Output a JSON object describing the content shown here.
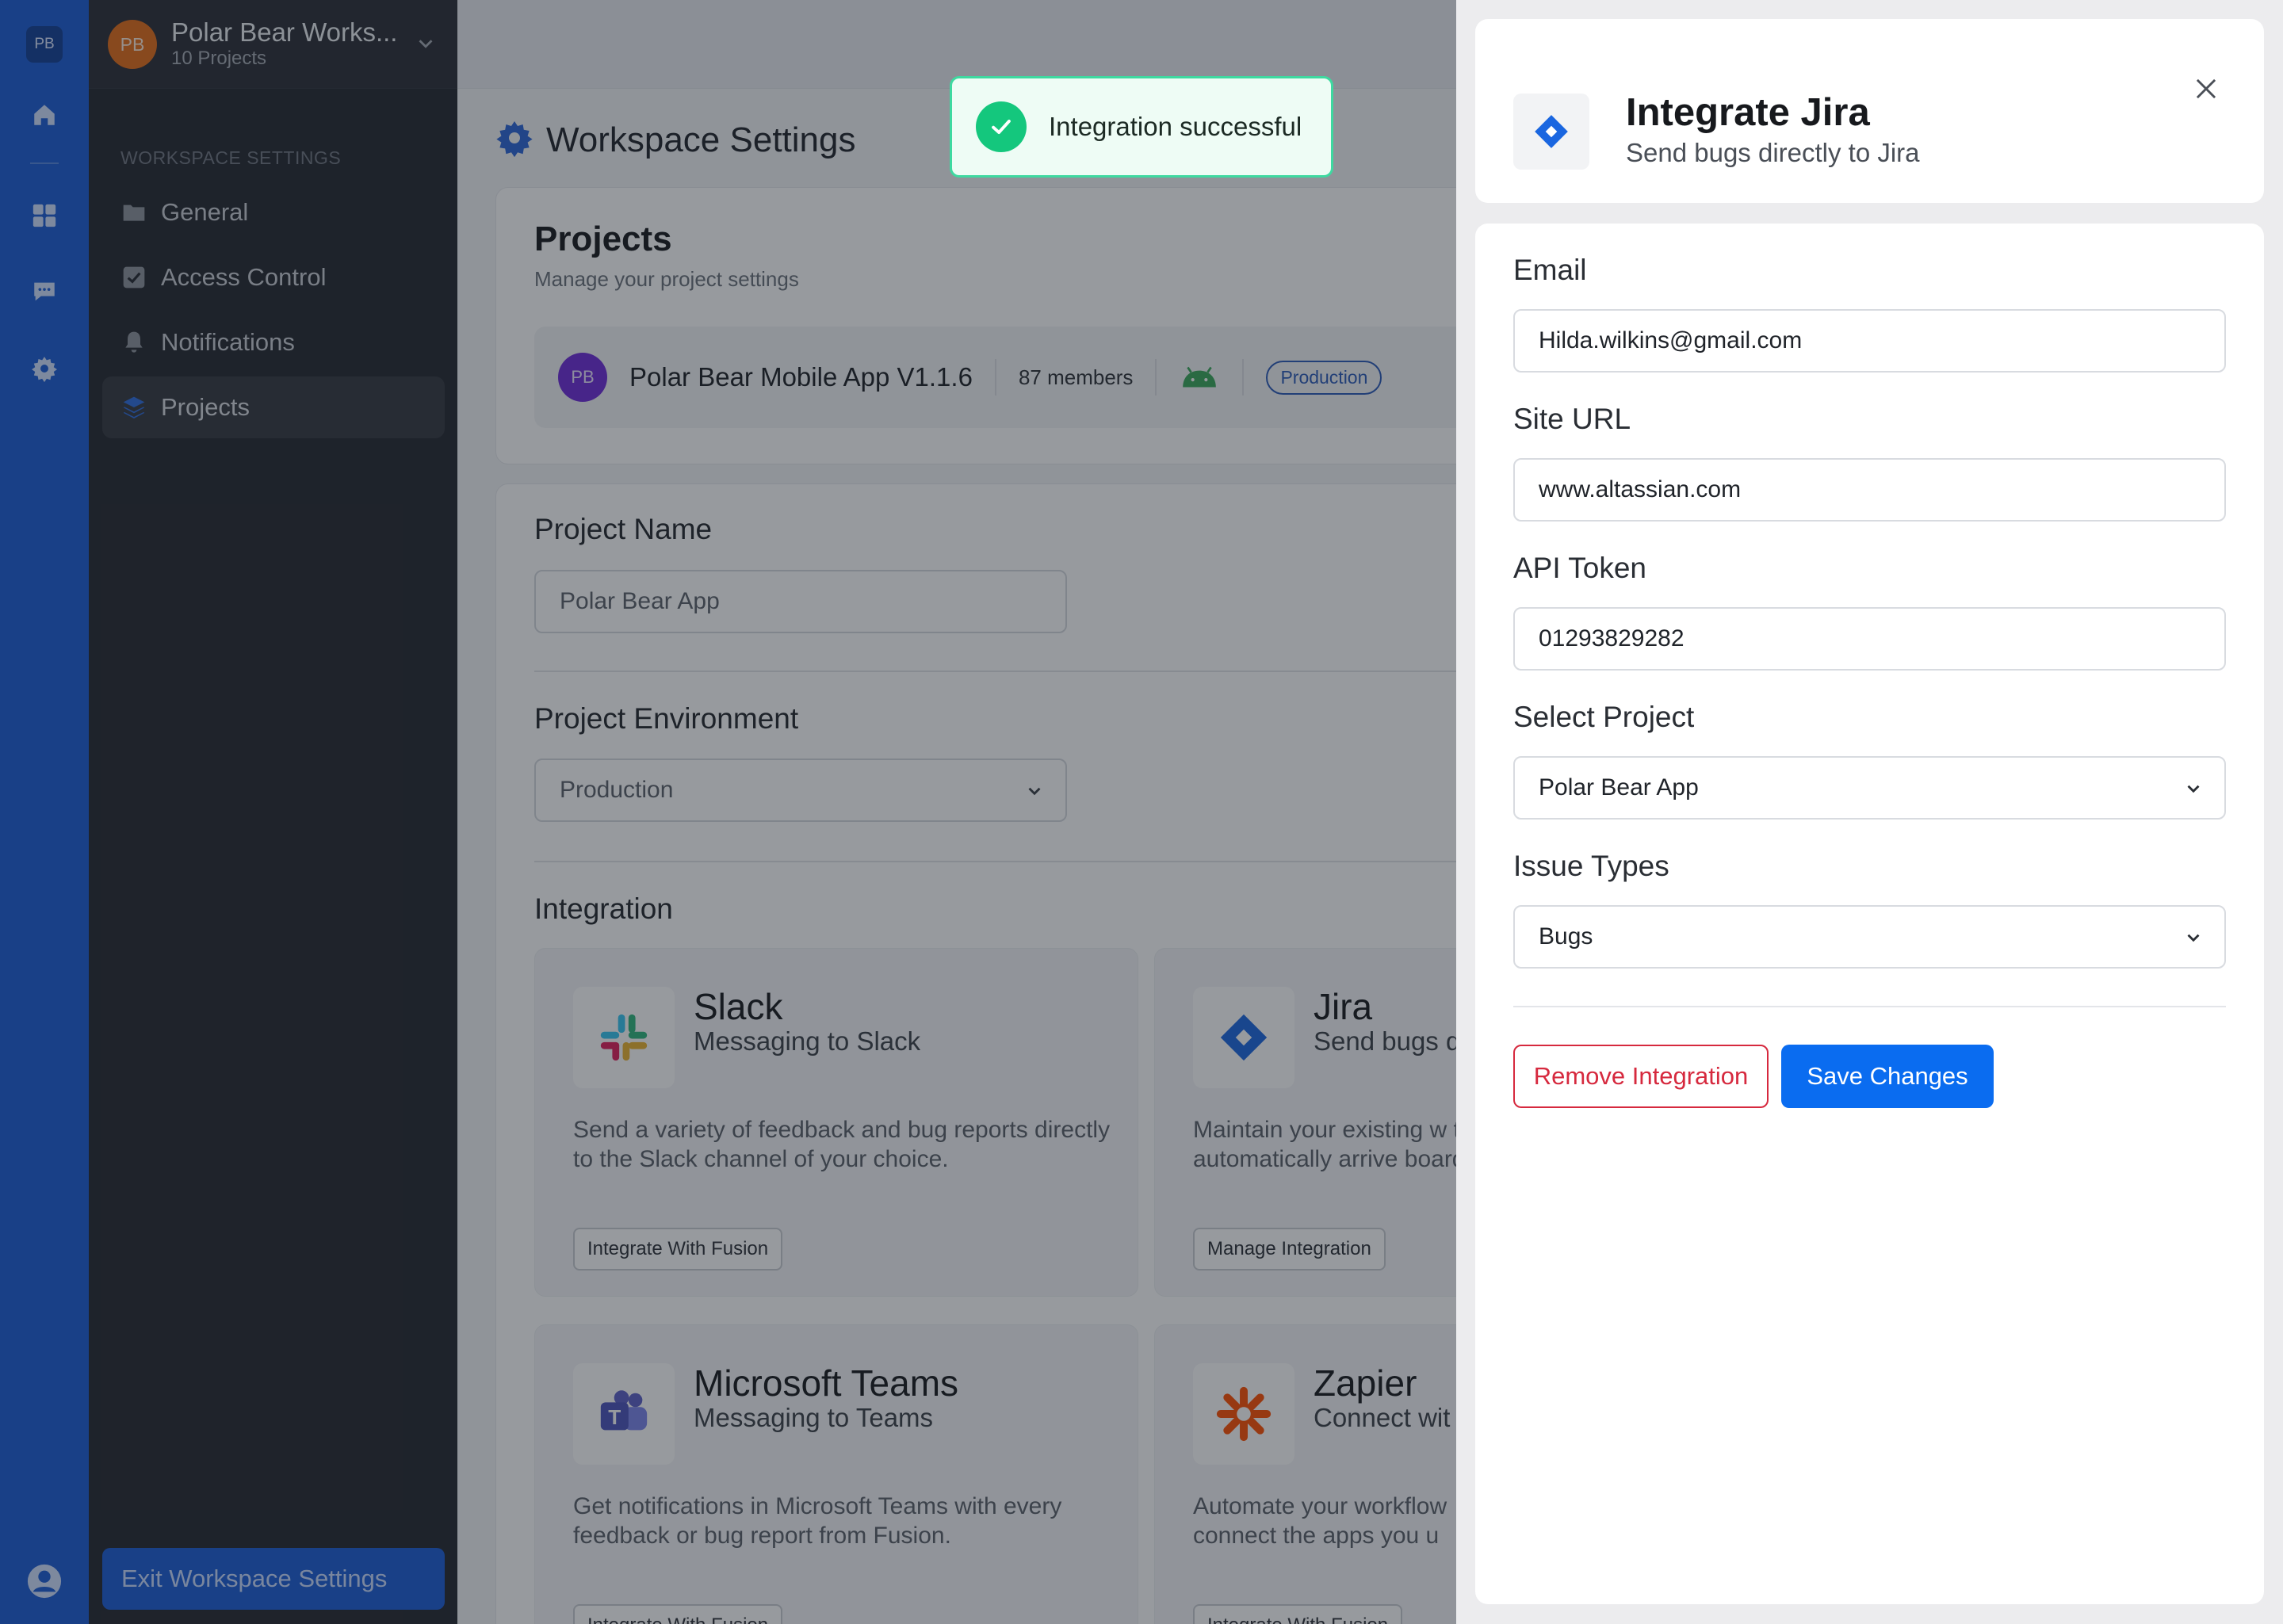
{
  "app": {
    "rail_badge": "PB",
    "workspace": {
      "avatar": "PB",
      "name": "Polar Bear Works...",
      "subtitle": "10 Projects"
    },
    "section_label": "WORKSPACE SETTINGS",
    "nav": [
      {
        "label": "General",
        "icon": "folder-icon",
        "active": false
      },
      {
        "label": "Access Control",
        "icon": "check-square-icon",
        "active": false
      },
      {
        "label": "Notifications",
        "icon": "bell-icon",
        "active": false
      },
      {
        "label": "Projects",
        "icon": "layers-icon",
        "active": true
      }
    ],
    "exit_label": "Exit Workspace Settings"
  },
  "main": {
    "page_title": "Workspace Settings",
    "projects": {
      "title": "Projects",
      "subtitle": "Manage your project settings",
      "row": {
        "avatar": "PB",
        "name": "Polar Bear Mobile App V1.1.6",
        "members": "87 members",
        "platform_icon": "android-icon",
        "badge": "Production"
      }
    },
    "project_name": {
      "label": "Project Name",
      "value": "Polar Bear App"
    },
    "project_environment": {
      "label": "Project Environment",
      "value": "Production"
    },
    "integration": {
      "label": "Integration",
      "cards": [
        {
          "title": "Slack",
          "subtitle": "Messaging to Slack",
          "description": "Send a variety of feedback and bug reports directly to the Slack channel of your choice.",
          "button": "Integrate With Fusion",
          "icon": "slack-icon"
        },
        {
          "title": "Jira",
          "subtitle": "Send bugs d",
          "description": "Maintain your existing w that automatically arrive board.",
          "button": "Manage Integration",
          "icon": "jira-icon"
        },
        {
          "title": "Microsoft Teams",
          "subtitle": "Messaging to Teams",
          "description": "Get notifications in Microsoft Teams with every feedback or bug report from Fusion.",
          "button": "Integrate With Fusion",
          "icon": "teams-icon"
        },
        {
          "title": "Zapier",
          "subtitle": "Connect wit",
          "description": "Automate your workflow connect the apps you u",
          "button": "Integrate With Fusion",
          "icon": "zapier-icon"
        }
      ]
    }
  },
  "toast": {
    "message": "Integration successful",
    "icon": "check-circle-icon",
    "color": "#14c77d"
  },
  "drawer": {
    "title": "Integrate Jira",
    "subtitle": "Send bugs directly to Jira",
    "fields": {
      "email": {
        "label": "Email",
        "value": "Hilda.wilkins@gmail.com"
      },
      "site_url": {
        "label": "Site URL",
        "value": "www.altassian.com"
      },
      "api_token": {
        "label": "API Token",
        "value": "01293829282"
      },
      "project": {
        "label": "Select Project",
        "value": "Polar Bear App"
      },
      "issue_types": {
        "label": "Issue Types",
        "value": "Bugs"
      }
    },
    "remove_label": "Remove Integration",
    "save_label": "Save Changes"
  },
  "colors": {
    "rail": "#1a5cd6",
    "sidebar": "#24272e",
    "primary_button": "#0a6cf0",
    "danger": "#d6293e",
    "success": "#14c77d"
  }
}
